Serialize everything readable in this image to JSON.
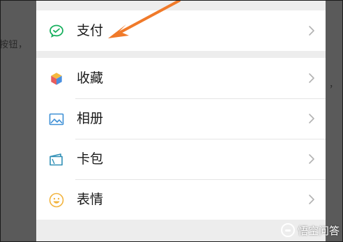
{
  "background_snippets": {
    "left_text": "按钮，",
    "right_text": "，"
  },
  "menu": {
    "pay_group": [
      {
        "label": "支付",
        "icon": "wechat-pay-icon"
      }
    ],
    "main_group": [
      {
        "label": "收藏",
        "icon": "favorites-cube-icon"
      },
      {
        "label": "相册",
        "icon": "album-picture-icon"
      },
      {
        "label": "卡包",
        "icon": "card-wallet-icon"
      },
      {
        "label": "表情",
        "icon": "sticker-smile-icon"
      }
    ]
  },
  "annotation": {
    "arrow_color": "#f07a2a"
  },
  "watermark": {
    "text": "悟空问答"
  },
  "colors": {
    "pay_green": "#19b05f",
    "chevron": "#b2b2b2",
    "row_background": "#ffffff",
    "group_separator": "#ededed"
  }
}
